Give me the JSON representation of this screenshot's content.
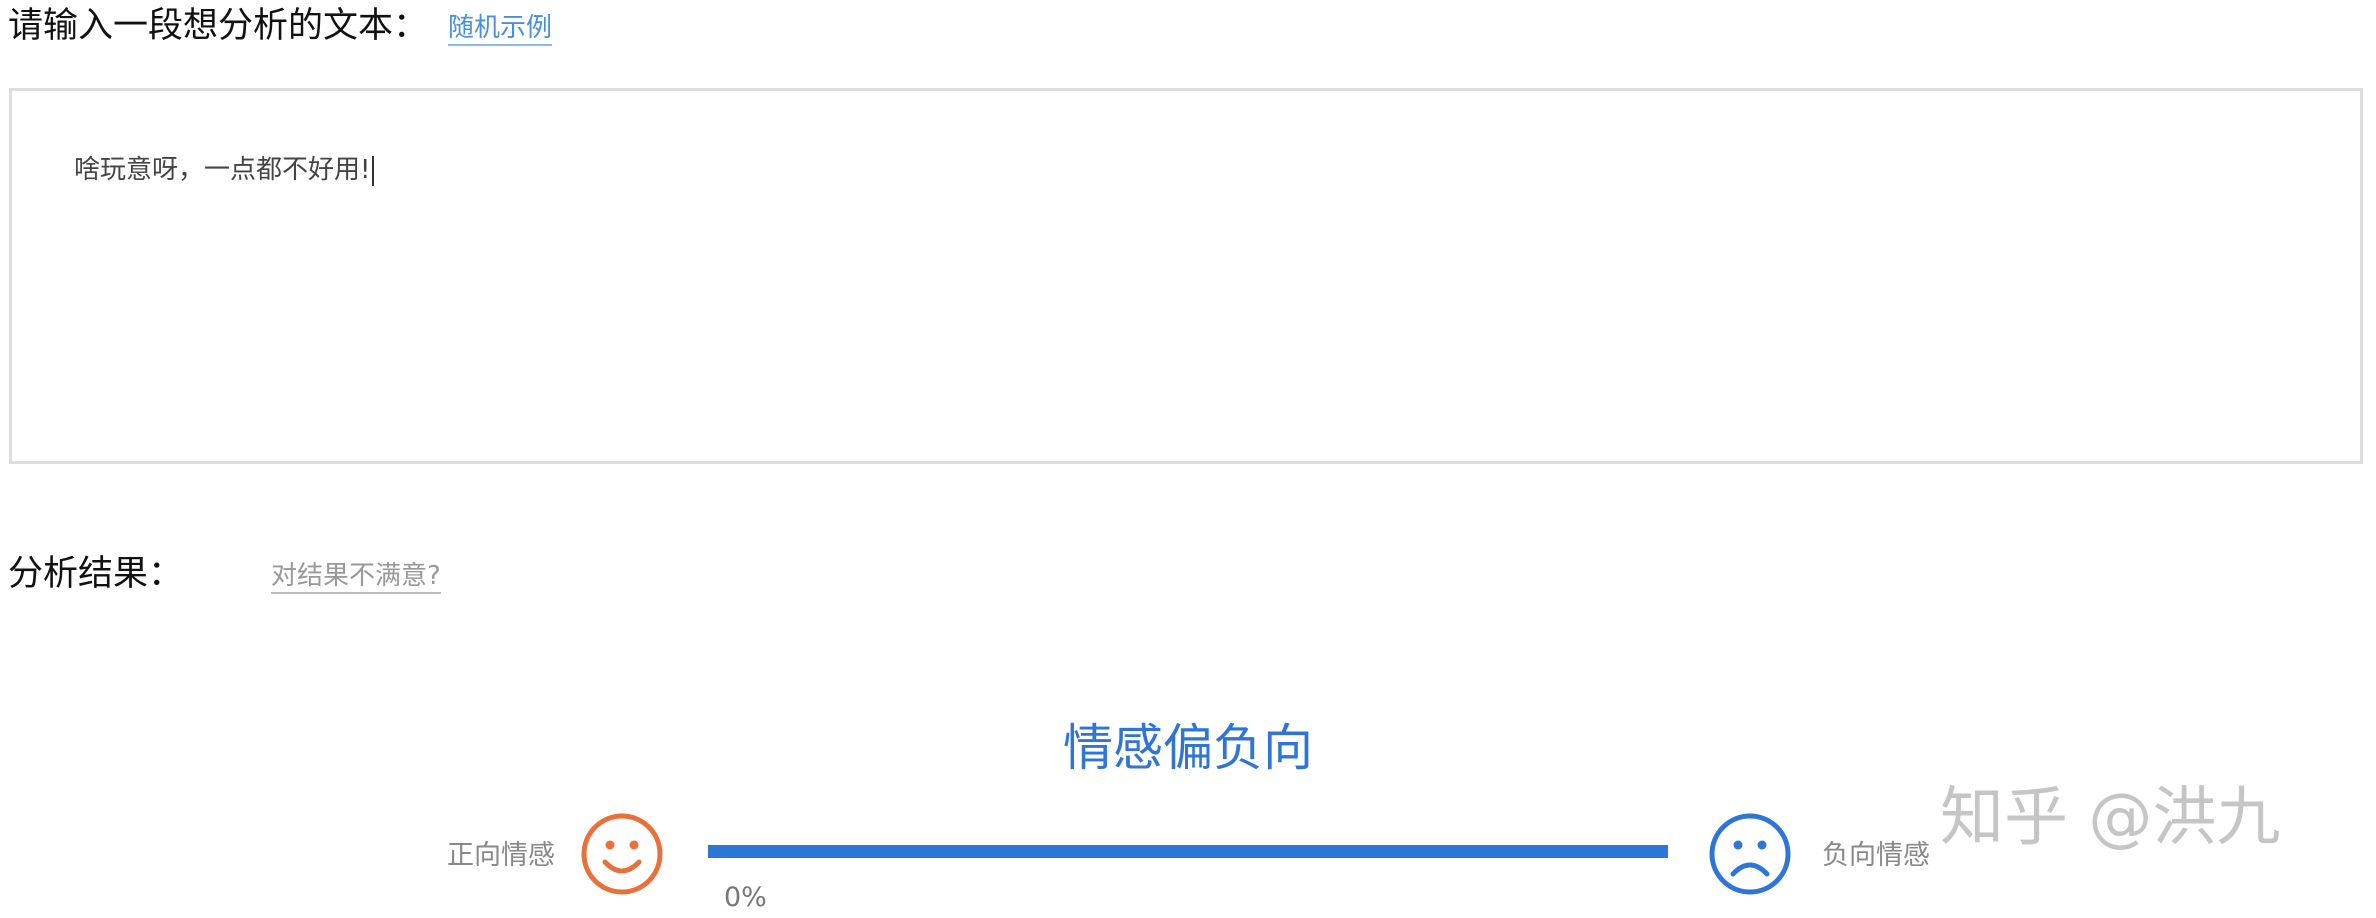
{
  "input_section": {
    "label": "请输入一段想分析的文本：",
    "random_example_link": "随机示例",
    "text_value": "啥玩意呀，一点都不好用!"
  },
  "result_section": {
    "label": "分析结果：",
    "feedback_link": "对结果不满意?",
    "verdict": "情感偏负向",
    "positive_label": "正向情感",
    "negative_label": "负向情感",
    "positive_percent_text": "0%",
    "negative_fraction": 1.0
  },
  "icons": {
    "positive": "smile-face-icon",
    "negative": "sad-face-icon"
  },
  "colors": {
    "link_blue": "#4a90d9",
    "accent_blue": "#2f75d6",
    "positive_orange": "#e8703a",
    "text_gray": "#888888"
  },
  "watermark": "知乎 @洪九"
}
